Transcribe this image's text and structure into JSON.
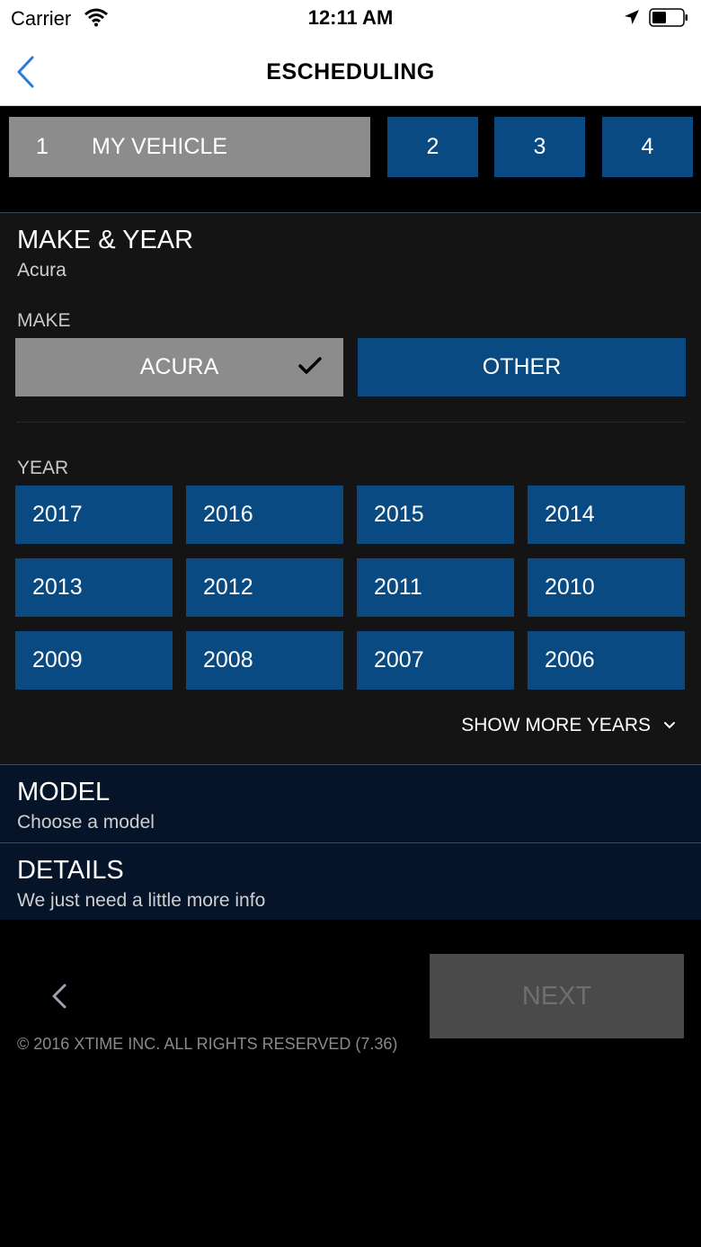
{
  "status_bar": {
    "carrier": "Carrier",
    "time": "12:11 AM"
  },
  "nav": {
    "title": "ESCHEDULING",
    "back_icon": "chevron-left-icon"
  },
  "steps": [
    {
      "number": "1",
      "label": "MY VEHICLE",
      "active": true
    },
    {
      "number": "2"
    },
    {
      "number": "3"
    },
    {
      "number": "4"
    }
  ],
  "make_year": {
    "title": "MAKE & YEAR",
    "subtitle": "Acura",
    "make_label": "MAKE",
    "makes": [
      {
        "label": "ACURA",
        "selected": true
      },
      {
        "label": "OTHER",
        "selected": false
      }
    ],
    "year_label": "YEAR",
    "years": [
      "2017",
      "2016",
      "2015",
      "2014",
      "2013",
      "2012",
      "2011",
      "2010",
      "2009",
      "2008",
      "2007",
      "2006"
    ],
    "show_more": "SHOW MORE YEARS"
  },
  "model": {
    "title": "MODEL",
    "subtitle": "Choose a model"
  },
  "details": {
    "title": "DETAILS",
    "subtitle": "We just need a little more info"
  },
  "footer": {
    "next_label": "NEXT",
    "copyright": "© 2016 XTIME INC. ALL RIGHTS RESERVED (7.36)"
  },
  "colors": {
    "accent_blue": "#0a4a82",
    "selected_gray": "#8c8c8c",
    "panel_bg": "#141414",
    "row_bg": "#06142a",
    "link_blue": "#2a7bd6"
  }
}
